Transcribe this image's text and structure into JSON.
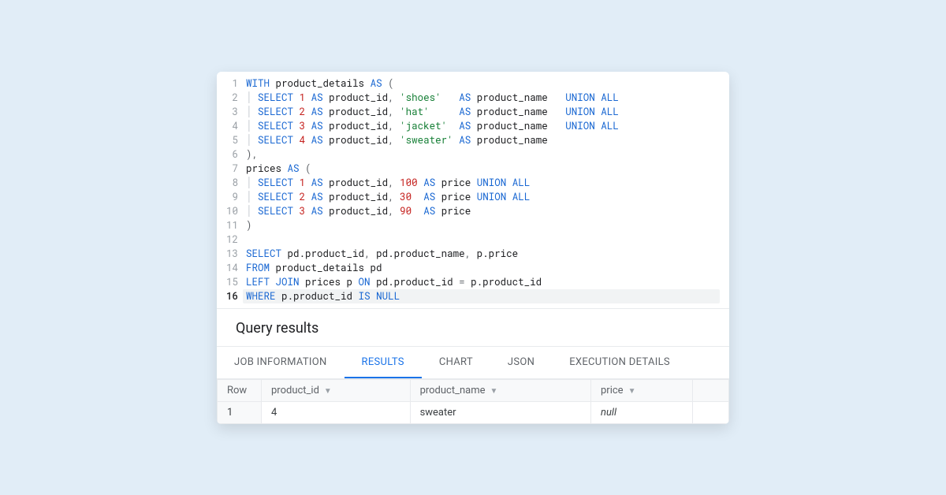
{
  "editor": {
    "lines": [
      [
        [
          "kw",
          "WITH"
        ],
        [
          "t",
          " product_details "
        ],
        [
          "kw",
          "AS"
        ],
        [
          "t",
          " "
        ],
        [
          "op",
          "("
        ]
      ],
      [
        [
          "guide",
          "│ "
        ],
        [
          "kw",
          "SELECT"
        ],
        [
          "t",
          " "
        ],
        [
          "num",
          "1"
        ],
        [
          "t",
          " "
        ],
        [
          "kw",
          "AS"
        ],
        [
          "t",
          " product_id"
        ],
        [
          "op",
          ","
        ],
        [
          "t",
          " "
        ],
        [
          "str",
          "'shoes'"
        ],
        [
          "t",
          "   "
        ],
        [
          "kw",
          "AS"
        ],
        [
          "t",
          " product_name   "
        ],
        [
          "kw",
          "UNION ALL"
        ]
      ],
      [
        [
          "guide",
          "│ "
        ],
        [
          "kw",
          "SELECT"
        ],
        [
          "t",
          " "
        ],
        [
          "num",
          "2"
        ],
        [
          "t",
          " "
        ],
        [
          "kw",
          "AS"
        ],
        [
          "t",
          " product_id"
        ],
        [
          "op",
          ","
        ],
        [
          "t",
          " "
        ],
        [
          "str",
          "'hat'"
        ],
        [
          "t",
          "     "
        ],
        [
          "kw",
          "AS"
        ],
        [
          "t",
          " product_name   "
        ],
        [
          "kw",
          "UNION ALL"
        ]
      ],
      [
        [
          "guide",
          "│ "
        ],
        [
          "kw",
          "SELECT"
        ],
        [
          "t",
          " "
        ],
        [
          "num",
          "3"
        ],
        [
          "t",
          " "
        ],
        [
          "kw",
          "AS"
        ],
        [
          "t",
          " product_id"
        ],
        [
          "op",
          ","
        ],
        [
          "t",
          " "
        ],
        [
          "str",
          "'jacket'"
        ],
        [
          "t",
          "  "
        ],
        [
          "kw",
          "AS"
        ],
        [
          "t",
          " product_name   "
        ],
        [
          "kw",
          "UNION ALL"
        ]
      ],
      [
        [
          "guide",
          "│ "
        ],
        [
          "kw",
          "SELECT"
        ],
        [
          "t",
          " "
        ],
        [
          "num",
          "4"
        ],
        [
          "t",
          " "
        ],
        [
          "kw",
          "AS"
        ],
        [
          "t",
          " product_id"
        ],
        [
          "op",
          ","
        ],
        [
          "t",
          " "
        ],
        [
          "str",
          "'sweater'"
        ],
        [
          "t",
          " "
        ],
        [
          "kw",
          "AS"
        ],
        [
          "t",
          " product_name"
        ]
      ],
      [
        [
          "op",
          ")"
        ],
        [
          "op",
          ","
        ]
      ],
      [
        [
          "t",
          "prices "
        ],
        [
          "kw",
          "AS"
        ],
        [
          "t",
          " "
        ],
        [
          "op",
          "("
        ]
      ],
      [
        [
          "guide",
          "│ "
        ],
        [
          "kw",
          "SELECT"
        ],
        [
          "t",
          " "
        ],
        [
          "num",
          "1"
        ],
        [
          "t",
          " "
        ],
        [
          "kw",
          "AS"
        ],
        [
          "t",
          " product_id"
        ],
        [
          "op",
          ","
        ],
        [
          "t",
          " "
        ],
        [
          "num",
          "100"
        ],
        [
          "t",
          " "
        ],
        [
          "kw",
          "AS"
        ],
        [
          "t",
          " price "
        ],
        [
          "kw",
          "UNION ALL"
        ]
      ],
      [
        [
          "guide",
          "│ "
        ],
        [
          "kw",
          "SELECT"
        ],
        [
          "t",
          " "
        ],
        [
          "num",
          "2"
        ],
        [
          "t",
          " "
        ],
        [
          "kw",
          "AS"
        ],
        [
          "t",
          " product_id"
        ],
        [
          "op",
          ","
        ],
        [
          "t",
          " "
        ],
        [
          "num",
          "30"
        ],
        [
          "t",
          "  "
        ],
        [
          "kw",
          "AS"
        ],
        [
          "t",
          " price "
        ],
        [
          "kw",
          "UNION ALL"
        ]
      ],
      [
        [
          "guide",
          "│ "
        ],
        [
          "kw",
          "SELECT"
        ],
        [
          "t",
          " "
        ],
        [
          "num",
          "3"
        ],
        [
          "t",
          " "
        ],
        [
          "kw",
          "AS"
        ],
        [
          "t",
          " product_id"
        ],
        [
          "op",
          ","
        ],
        [
          "t",
          " "
        ],
        [
          "num",
          "90"
        ],
        [
          "t",
          "  "
        ],
        [
          "kw",
          "AS"
        ],
        [
          "t",
          " price"
        ]
      ],
      [
        [
          "op",
          ")"
        ]
      ],
      [],
      [
        [
          "kw",
          "SELECT"
        ],
        [
          "t",
          " pd.product_id"
        ],
        [
          "op",
          ","
        ],
        [
          "t",
          " pd.product_name"
        ],
        [
          "op",
          ","
        ],
        [
          "t",
          " p.price"
        ]
      ],
      [
        [
          "kw",
          "FROM"
        ],
        [
          "t",
          " product_details pd"
        ]
      ],
      [
        [
          "kw",
          "LEFT JOIN"
        ],
        [
          "t",
          " prices p "
        ],
        [
          "kw",
          "ON"
        ],
        [
          "t",
          " pd.product_id "
        ],
        [
          "op",
          "="
        ],
        [
          "t",
          " p.product_id"
        ]
      ],
      [
        [
          "kw",
          "WHERE"
        ],
        [
          "t",
          " p.product_id "
        ],
        [
          "kw",
          "IS NULL"
        ]
      ]
    ],
    "active_line": 16
  },
  "results": {
    "header": "Query results",
    "tabs": [
      {
        "label": "JOB INFORMATION",
        "active": false
      },
      {
        "label": "RESULTS",
        "active": true
      },
      {
        "label": "CHART",
        "active": false
      },
      {
        "label": "JSON",
        "active": false
      },
      {
        "label": "EXECUTION DETAILS",
        "active": false
      }
    ],
    "columns": [
      "Row",
      "product_id",
      "product_name",
      "price"
    ],
    "rows": [
      {
        "row": "1",
        "product_id": "4",
        "product_name": "sweater",
        "price": "null"
      }
    ]
  }
}
